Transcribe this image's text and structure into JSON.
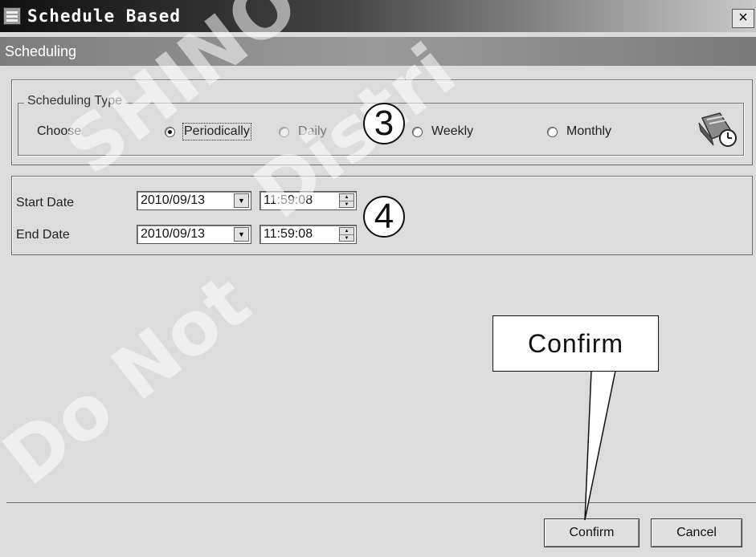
{
  "window": {
    "title": "Schedule Based",
    "close_label": "×",
    "header": "Scheduling"
  },
  "scheduling_type": {
    "legend": "Scheduling Type",
    "choose_label": "Choose",
    "options": [
      {
        "label": "Periodically",
        "selected": true,
        "enabled": true
      },
      {
        "label": "Daily",
        "selected": false,
        "enabled": false
      },
      {
        "label": "Weekly",
        "selected": false,
        "enabled": true
      },
      {
        "label": "Monthly",
        "selected": false,
        "enabled": true
      }
    ]
  },
  "dates": {
    "start_label": "Start Date",
    "start_date": "2010/09/13",
    "start_time": "11:59:08",
    "end_label": "End Date",
    "end_date": "2010/09/13",
    "end_time": "11:59:08"
  },
  "buttons": {
    "confirm": "Confirm",
    "cancel": "Cancel"
  },
  "annotations": {
    "step3": "3",
    "step4": "4",
    "callout": "Confirm"
  },
  "watermark": {
    "line1": "SHINO",
    "line2": "Distri",
    "line3": "Do Not"
  }
}
